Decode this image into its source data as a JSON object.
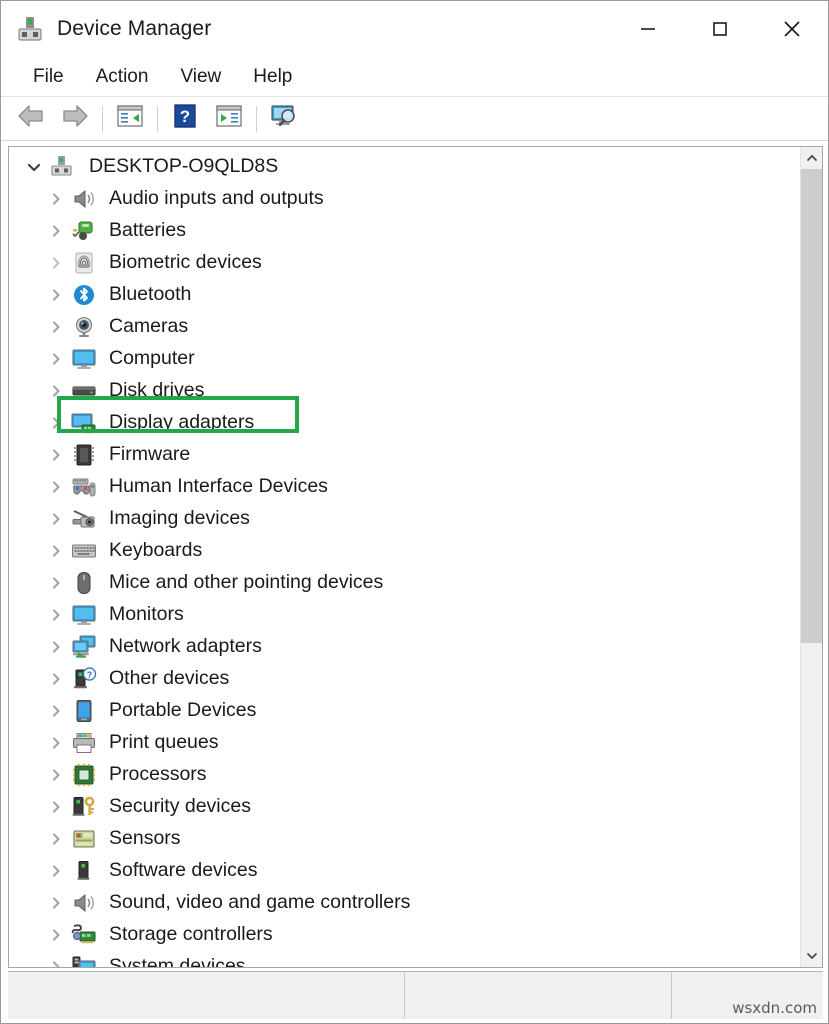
{
  "window": {
    "title": "Device Manager",
    "app_icon": "device-manager-icon",
    "controls": {
      "minimize": "minimize-button",
      "maximize": "maximize-button",
      "close": "close-button"
    }
  },
  "menubar": {
    "items": [
      {
        "label": "File",
        "name": "menu-file"
      },
      {
        "label": "Action",
        "name": "menu-action"
      },
      {
        "label": "View",
        "name": "menu-view"
      },
      {
        "label": "Help",
        "name": "menu-help"
      }
    ]
  },
  "toolbar": {
    "buttons": [
      {
        "name": "back-button",
        "icon": "back-arrow-icon"
      },
      {
        "name": "forward-button",
        "icon": "forward-arrow-icon"
      },
      {
        "name": "properties-button",
        "icon": "properties-icon"
      },
      {
        "name": "help-button",
        "icon": "help-question-icon"
      },
      {
        "name": "update-driver-button",
        "icon": "update-driver-icon"
      },
      {
        "name": "scan-hardware-button",
        "icon": "scan-hardware-changes-icon"
      }
    ]
  },
  "tree": {
    "root": {
      "label": "DESKTOP-O9QLD8S",
      "icon": "computer-root-icon",
      "expanded": true
    },
    "items": [
      {
        "label": "Audio inputs and outputs",
        "icon": "speaker-icon"
      },
      {
        "label": "Batteries",
        "icon": "battery-icon"
      },
      {
        "label": "Biometric devices",
        "icon": "fingerprint-icon",
        "highlighted": true
      },
      {
        "label": "Bluetooth",
        "icon": "bluetooth-icon"
      },
      {
        "label": "Cameras",
        "icon": "camera-icon"
      },
      {
        "label": "Computer",
        "icon": "monitor-icon"
      },
      {
        "label": "Disk drives",
        "icon": "disk-drive-icon"
      },
      {
        "label": "Display adapters",
        "icon": "display-adapter-icon"
      },
      {
        "label": "Firmware",
        "icon": "firmware-chip-icon"
      },
      {
        "label": "Human Interface Devices",
        "icon": "gamepad-icon"
      },
      {
        "label": "Imaging devices",
        "icon": "scanner-icon"
      },
      {
        "label": "Keyboards",
        "icon": "keyboard-icon"
      },
      {
        "label": "Mice and other pointing devices",
        "icon": "mouse-icon"
      },
      {
        "label": "Monitors",
        "icon": "monitor-icon"
      },
      {
        "label": "Network adapters",
        "icon": "network-adapter-icon"
      },
      {
        "label": "Other devices",
        "icon": "unknown-device-icon"
      },
      {
        "label": "Portable Devices",
        "icon": "portable-device-icon"
      },
      {
        "label": "Print queues",
        "icon": "printer-icon"
      },
      {
        "label": "Processors",
        "icon": "processor-chip-icon"
      },
      {
        "label": "Security devices",
        "icon": "security-key-icon"
      },
      {
        "label": "Sensors",
        "icon": "sensor-icon"
      },
      {
        "label": "Software devices",
        "icon": "software-device-icon"
      },
      {
        "label": "Sound, video and game controllers",
        "icon": "speaker-icon"
      },
      {
        "label": "Storage controllers",
        "icon": "storage-controller-icon"
      },
      {
        "label": "System devices",
        "icon": "system-device-icon"
      }
    ]
  },
  "scrollbar": {
    "up_arrow": "scroll-up-arrow-icon",
    "down_arrow": "scroll-down-arrow-icon"
  },
  "statusbar": {
    "pane1": "",
    "pane2": "",
    "pane3": "",
    "watermark": "wsxdn.com"
  },
  "colors": {
    "highlight_green": "#22a84a",
    "accent_blue": "#1f8ad2",
    "window_bg": "#ffffff",
    "statusbar_bg": "#f0f0f0"
  }
}
